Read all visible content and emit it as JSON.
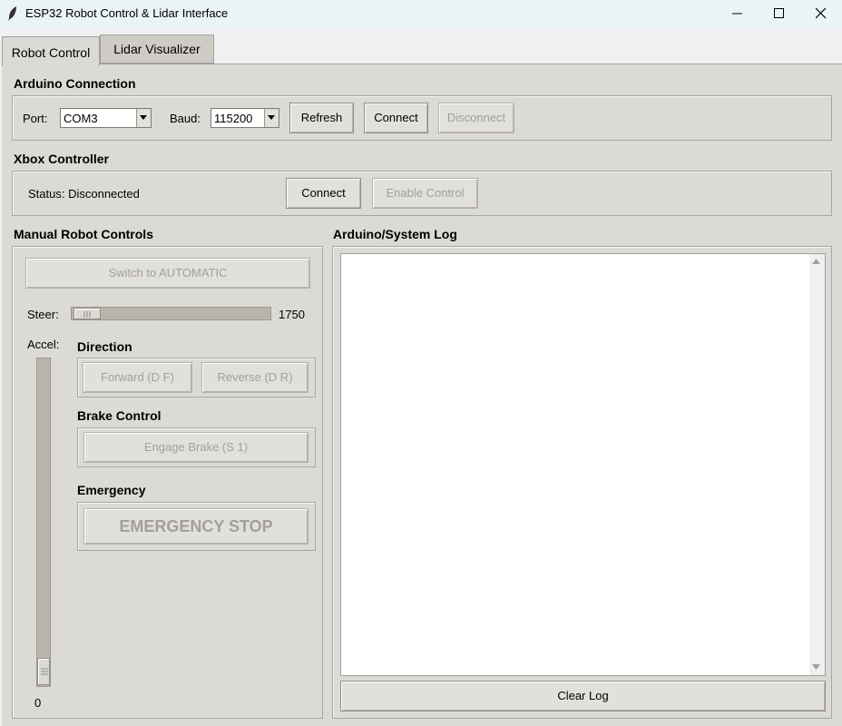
{
  "window": {
    "title": "ESP32 Robot Control & Lidar Interface"
  },
  "tabs": [
    {
      "label": "Robot Control",
      "active": true
    },
    {
      "label": "Lidar Visualizer",
      "active": false
    }
  ],
  "arduino": {
    "title": "Arduino Connection",
    "port_label": "Port:",
    "port_value": "COM3",
    "baud_label": "Baud:",
    "baud_value": "115200",
    "refresh_label": "Refresh",
    "connect_label": "Connect",
    "disconnect_label": "Disconnect"
  },
  "xbox": {
    "title": "Xbox Controller",
    "status_text": "Status: Disconnected",
    "connect_label": "Connect",
    "enable_label": "Enable Control"
  },
  "manual": {
    "title": "Manual Robot Controls",
    "switch_label": "Switch to AUTOMATIC",
    "steer_label": "Steer:",
    "steer_value": "1750",
    "accel_label": "Accel:",
    "accel_value": "0",
    "direction_title": "Direction",
    "forward_label": "Forward (D F)",
    "reverse_label": "Reverse (D R)",
    "brake_title": "Brake Control",
    "brake_label": "Engage Brake (S 1)",
    "emergency_title": "Emergency",
    "estop_label": "EMERGENCY STOP"
  },
  "log": {
    "title": "Arduino/System Log",
    "clear_label": "Clear Log"
  },
  "icons": {
    "app": "feather-icon",
    "minimize": "minimize-icon",
    "maximize": "maximize-icon",
    "close": "close-icon"
  }
}
